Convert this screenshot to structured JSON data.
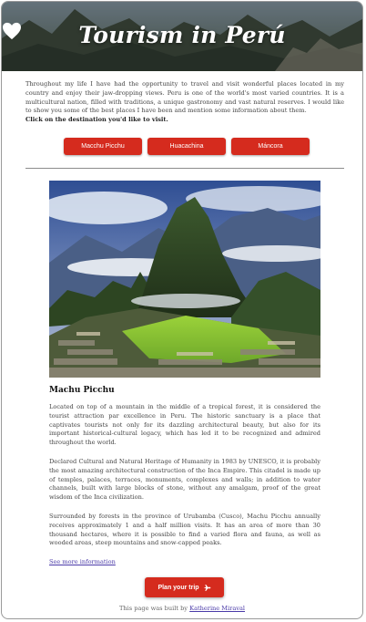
{
  "header": {
    "title": "Tourism in Perú",
    "icon": "heart-icon"
  },
  "intro": {
    "text": "Throughout my life I have had the opportunity to travel and visit wonderful places located in my country and enjoy their jaw-dropping views. Peru is one of the world's most varied countries. It is a multicultural nation, filled with traditions, a unique gastronomy and vast natural reserves. I would like to show you some of the best places I have been and mention some information about them.",
    "cta": "Click on the destination you'd like to visit."
  },
  "destinations": [
    {
      "label": "Macchu Picchu"
    },
    {
      "label": "Huacachina"
    },
    {
      "label": "Máncora"
    }
  ],
  "article": {
    "title": "Machu Picchu",
    "paragraphs": [
      "Located on top of a mountain in the middle of a tropical forest, it is considered the tourist attraction par excellence in Peru. The historic sanctuary is a place that captivates tourists not only for its dazzling architectural beauty, but also for its important historical-cultural legacy, which has led it to be recognized and admired throughout the world.",
      "Declared Cultural and Natural Heritage of Humanity in 1983 by UNESCO, it is probably the most amazing architectural construction of the Inca Empire. This citadel is made up of temples, palaces, terraces, monuments, complexes and walls; in addition to water channels, built with large blocks of stone, without any amalgam, proof of the great wisdom of the Inca civilization.",
      "Surrounded by forests in the province of Urubamba (Cusco), Machu Picchu annually receives approximately 1 and a half million visits. It has an area of more than 30 thousand hectares, where it is possible to find a varied flora and fauna, as well as wooded areas, steep mountains and snow-capped peaks."
    ],
    "more_link": "See more information"
  },
  "plan_button": {
    "label": "Plan your trip",
    "icon": "airplane-icon"
  },
  "footer": {
    "text": "This page was built by",
    "author": "Katherine Miraval"
  },
  "colors": {
    "accent": "#d52b1e",
    "link": "#4a3aa8"
  }
}
